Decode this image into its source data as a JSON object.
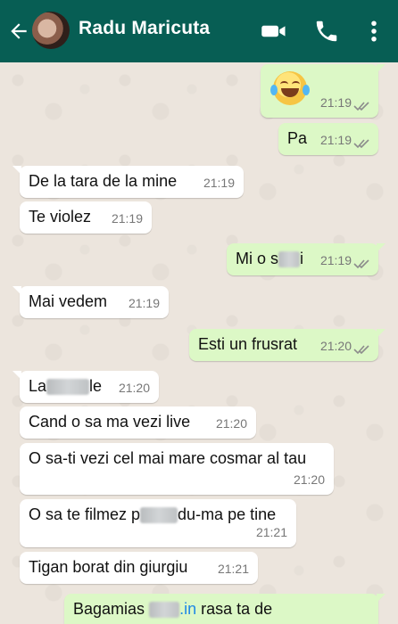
{
  "header": {
    "contact_name": "Radu Maricuta",
    "icons": [
      "back-arrow-icon",
      "avatar",
      "video-call-icon",
      "phone-icon",
      "more-options-icon"
    ],
    "background": "#075e54"
  },
  "messages": [
    {
      "dir": "out",
      "text": "",
      "emoji": "face-with-tears-of-joy",
      "time": "21:19",
      "ticks": "double"
    },
    {
      "dir": "out",
      "text": "Pa",
      "time": "21:19",
      "ticks": "double"
    },
    {
      "dir": "in",
      "text": "De la tara de la mine",
      "time": "21:19"
    },
    {
      "dir": "in",
      "text": "Te violez",
      "time": "21:19"
    },
    {
      "dir": "out",
      "text_a": "Mi o s",
      "text_b": "i",
      "time": "21:19",
      "ticks": "double"
    },
    {
      "dir": "in",
      "text": "Mai vedem",
      "time": "21:19"
    },
    {
      "dir": "out",
      "text": "Esti un frusrat",
      "time": "21:20",
      "ticks": "double"
    },
    {
      "dir": "in",
      "text_a": "La",
      "text_b": "le",
      "time": "21:20"
    },
    {
      "dir": "in",
      "text": "Cand o sa ma vezi live",
      "time": "21:20"
    },
    {
      "dir": "in",
      "text": "O sa-ti vezi cel mai mare cosmar al tau",
      "time": "21:20"
    },
    {
      "dir": "in",
      "text_a": "O sa te filmez p",
      "text_b": "du-ma pe tine",
      "time": "21:21"
    },
    {
      "dir": "in",
      "text": "Tigan borat din giurgiu",
      "time": "21:21"
    },
    {
      "dir": "out",
      "text_a": "Bagamias",
      "text_link": ".in",
      "text_b": "rasa ta de",
      "time": "",
      "ticks": ""
    }
  ],
  "colors": {
    "incoming": "#ffffff",
    "outgoing": "#dcf8c6",
    "chat_bg": "#ece5dd",
    "link": "#1e88e5",
    "ticks": "#8c8c8c"
  }
}
